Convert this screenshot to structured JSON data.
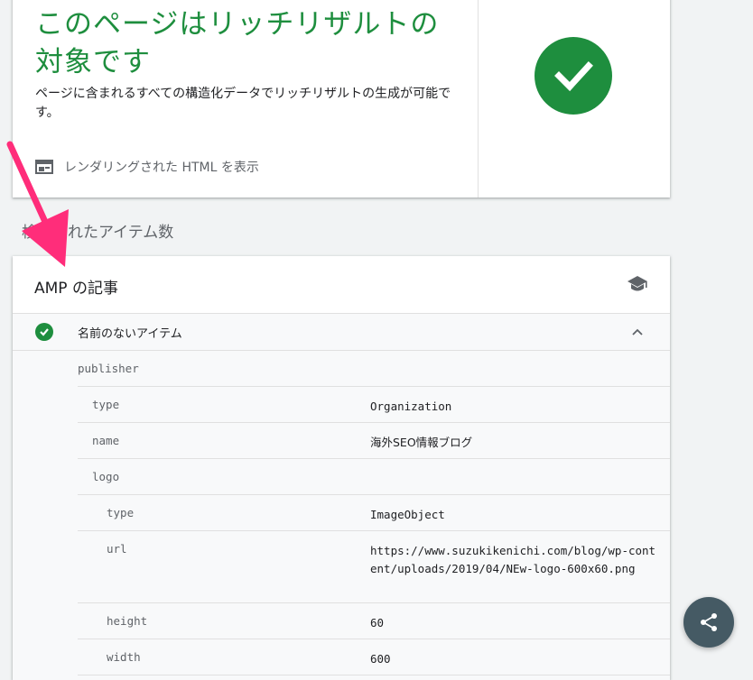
{
  "result": {
    "title": "このページはリッチリザルトの対象です",
    "description": "ページに含まれるすべての構造化データでリッチリザルトの生成が可能です。",
    "view_html_label": "レンダリングされた HTML を表示"
  },
  "section_label": "検出されたアイテム数",
  "amp_card": {
    "title": "AMP の記事",
    "item_name": "名前のないアイテム",
    "properties": [
      {
        "key": "publisher",
        "value": "",
        "indent": 0
      },
      {
        "key": "type",
        "value": "Organization",
        "indent": 1
      },
      {
        "key": "name",
        "value": "海外SEO情報ブログ",
        "indent": 1
      },
      {
        "key": "logo",
        "value": "",
        "indent": 1
      },
      {
        "key": "type",
        "value": "ImageObject",
        "indent": 2
      },
      {
        "key": "url",
        "value": "https://www.suzukikenichi.com/blog/wp-content/uploads/2019/04/NEw-logo-600x60.png",
        "indent": 2
      },
      {
        "key": "height",
        "value": "60",
        "indent": 2
      },
      {
        "key": "width",
        "value": "600",
        "indent": 2
      }
    ]
  },
  "colors": {
    "success_green": "#1e8e3e",
    "annotation_arrow": "#ff2d7a",
    "fab": "#455a64"
  },
  "icons": [
    "check-circle-icon",
    "html-window-icon",
    "school-cap-icon",
    "chevron-up-icon",
    "share-icon"
  ]
}
